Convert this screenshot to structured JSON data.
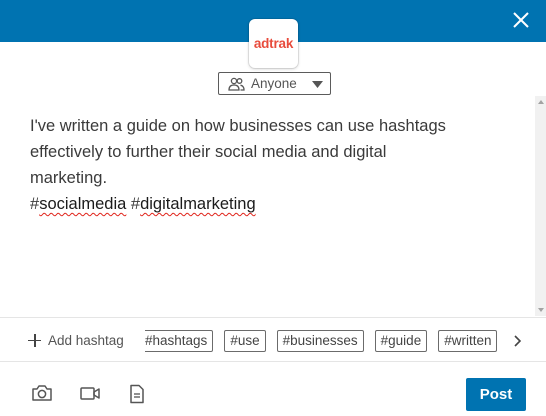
{
  "header": {
    "close_icon": "close-icon",
    "accent_color": "#0073b1"
  },
  "company": {
    "logo_text": "adtrak",
    "logo_color": "#e84b3c"
  },
  "audience": {
    "label": "Anyone",
    "icon": "people-icon"
  },
  "post": {
    "line1": "I've written a guide on how businesses can use hashtags",
    "line2": "effectively to further their social media and digital",
    "line3": "marketing.",
    "hashtags": [
      "socialmedia",
      "digitalmarketing"
    ]
  },
  "hashtag_bar": {
    "add_label": "Add hashtag",
    "suggestions": [
      "#hashtags",
      "#use",
      "#businesses",
      "#guide",
      "#written"
    ]
  },
  "toolbar": {
    "icons": [
      "camera-icon",
      "video-icon",
      "document-icon"
    ],
    "post_label": "Post"
  }
}
